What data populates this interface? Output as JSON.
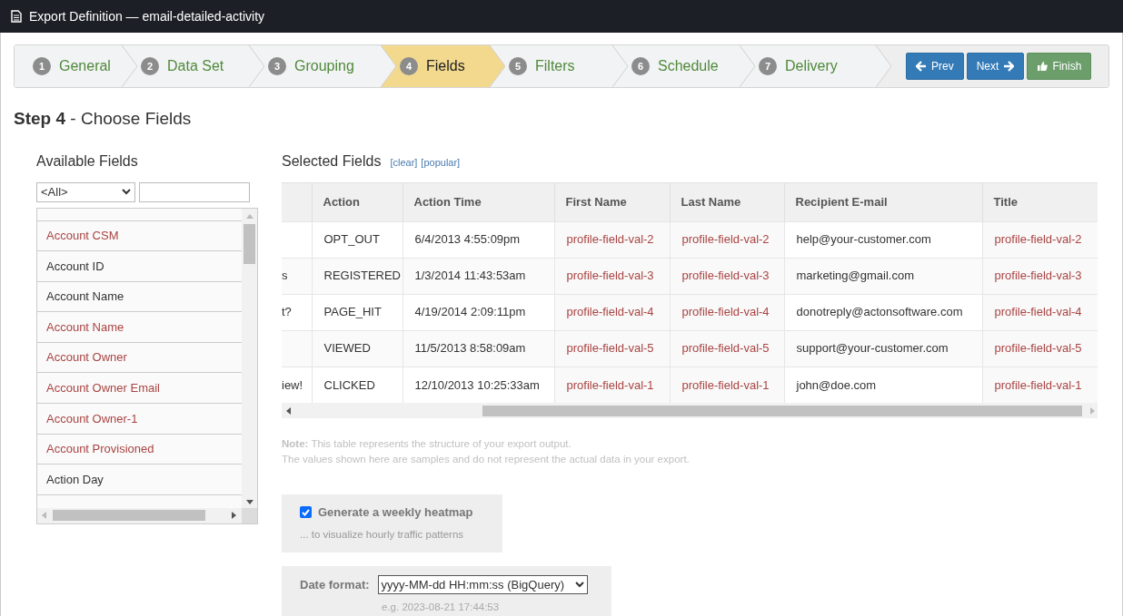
{
  "window": {
    "title": "Export Definition — email-detailed-activity"
  },
  "steps": [
    {
      "number": "1",
      "label": "General",
      "selected": false
    },
    {
      "number": "2",
      "label": "Data Set",
      "selected": false
    },
    {
      "number": "3",
      "label": "Grouping",
      "selected": false
    },
    {
      "number": "4",
      "label": "Fields",
      "selected": true
    },
    {
      "number": "5",
      "label": "Filters",
      "selected": false
    },
    {
      "number": "6",
      "label": "Schedule",
      "selected": false
    },
    {
      "number": "7",
      "label": "Delivery",
      "selected": false
    }
  ],
  "nav_buttons": [
    {
      "kind": "prev",
      "label": "Prev"
    },
    {
      "kind": "next",
      "label": "Next"
    },
    {
      "kind": "finish",
      "label": "Finish"
    }
  ],
  "heading": "**Step 4** - Choose Fields",
  "available_fields": {
    "title": "Available Fields",
    "filter": "<All>",
    "items": [
      {
        "label": "Account CSM",
        "color": "#a94442"
      },
      {
        "label": "Account ID",
        "color": "#333333"
      },
      {
        "label": "Account Name",
        "color": "#333333"
      },
      {
        "label": "Account Name",
        "color": "#a94442"
      },
      {
        "label": "Account Owner",
        "color": "#a94442"
      },
      {
        "label": "Account Owner Email",
        "color": "#a94442"
      },
      {
        "label": "Account Owner-1",
        "color": "#a94442"
      },
      {
        "label": "Account Provisioned",
        "color": "#a94442"
      },
      {
        "label": "Action Day",
        "color": "#333333"
      }
    ]
  },
  "selected_fields": {
    "title": "Selected Fields",
    "links": [
      "[clear]",
      "[popular]"
    ],
    "columns": [
      {
        "label": "Action",
        "kind": "plain"
      },
      {
        "label": "Action Time",
        "kind": "plain"
      },
      {
        "label": "First Name",
        "kind": "profile"
      },
      {
        "label": "Last Name",
        "kind": "profile"
      },
      {
        "label": "Recipient E-mail",
        "kind": "plain"
      },
      {
        "label": "Title",
        "kind": "profile"
      }
    ],
    "rows": [
      {
        "cells": [
          "OPT_OUT",
          "6/4/2013 4:55:09pm",
          "profile-field-val-2",
          "profile-field-val-2",
          "help@your-customer.com",
          "profile-field-val-2"
        ]
      },
      {
        "column_1": "s",
        "cells": [
          "REGISTERED",
          "1/3/2014 11:43:53am",
          "profile-field-val-3",
          "profile-field-val-3",
          "marketing@gmail.com",
          "profile-field-val-3"
        ]
      },
      {
        "column_1": "t?",
        "cells": [
          "PAGE_HIT",
          "4/19/2014 2:09:11pm",
          "profile-field-val-4",
          "profile-field-val-4",
          "donotreply@actonsoftware.com",
          "profile-field-val-4"
        ]
      },
      {
        "cells": [
          "VIEWED",
          "11/5/2013 8:58:09am",
          "profile-field-val-5",
          "profile-field-val-5",
          "support@your-customer.com",
          "profile-field-val-5"
        ]
      },
      {
        "column_1": "iew!",
        "cells": [
          "CLICKED",
          "12/10/2013 10:25:33am",
          "profile-field-val-1",
          "profile-field-val-1",
          "john@doe.com",
          "profile-field-val-1"
        ]
      }
    ]
  },
  "note": [
    "**Note:** This table represents the structure of your export output.",
    "The values shown here are samples and do not represent the actual data in your export."
  ],
  "heatmap": {
    "checked": true,
    "label": "Generate a weekly heatmap",
    "hint": "... to visualize hourly traffic patterns"
  },
  "date_format": {
    "label": "Date format:",
    "value": "yyyy-MM-dd HH:mm:ss (BigQuery)",
    "example": "e.g. 2023-08-21 17:44:53"
  }
}
